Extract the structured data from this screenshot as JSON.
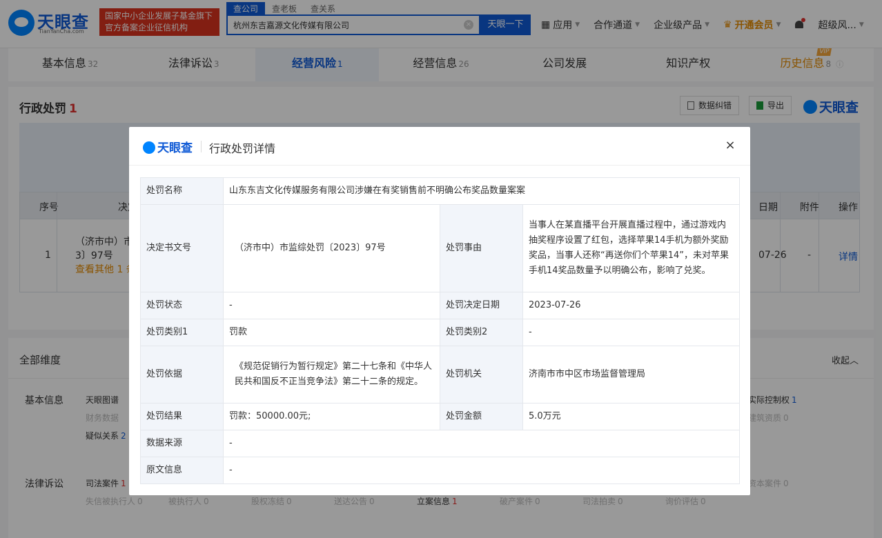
{
  "header": {
    "logo_text": "天眼查",
    "logo_sub": "TianYanCha.com",
    "gov_badge_line1": "国家中小企业发展子基金旗下",
    "gov_badge_line2": "官方备案企业征信机构",
    "search_tabs": [
      "查公司",
      "查老板",
      "查关系"
    ],
    "search_value": "杭州东吉嘉源文化传媒有限公司",
    "search_button": "天眼一下",
    "nav": {
      "apps": "应用",
      "partner": "合作通道",
      "enterprise": "企业级产品",
      "vip": "开通会员",
      "user": "超级风..."
    }
  },
  "tabs": [
    {
      "label": "基本信息",
      "count": "32"
    },
    {
      "label": "法律诉讼",
      "count": "3"
    },
    {
      "label": "经营风险",
      "count": "1"
    },
    {
      "label": "经营信息",
      "count": "26"
    },
    {
      "label": "公司发展",
      "count": ""
    },
    {
      "label": "知识产权",
      "count": ""
    },
    {
      "label": "历史信息",
      "count": "8"
    }
  ],
  "vip_tag": "VIP",
  "section": {
    "title": "行政处罚",
    "count": "1",
    "btn_correct": "数据纠错",
    "btn_export": "导出",
    "brand": "天眼查",
    "table_headers": {
      "index": "序号",
      "decision": "决定",
      "date": "日期",
      "attachment": "附件",
      "action": "操作"
    },
    "row": {
      "index": "1",
      "decision_line1": "（济市中）市监",
      "decision_line2": "3〕97号",
      "more": "查看其他 1 条",
      "date": "07-26",
      "attachment": "-",
      "action": "详情"
    }
  },
  "dims": {
    "title": "全部维度",
    "collapse": "收起",
    "basic": {
      "label": "基本信息",
      "item1": "天眼图谱",
      "item2": "财务数据",
      "item3": "疑似关系",
      "item3_count": "2",
      "right1": "实际控制权",
      "right1_count": "1",
      "right2": "建筑资质",
      "right2_count": "0"
    },
    "legal": {
      "label": "法律诉讼",
      "items_row1": [
        {
          "label": "司法案件",
          "count": "1"
        },
        {
          "label": "资本案件",
          "count": "0"
        }
      ],
      "items_row2": [
        {
          "label": "失信被执行人",
          "count": "0"
        },
        {
          "label": "被执行人",
          "count": "0"
        },
        {
          "label": "股权冻结",
          "count": "0"
        },
        {
          "label": "送达公告",
          "count": "0"
        },
        {
          "label": "立案信息",
          "count": "1"
        },
        {
          "label": "破产案件",
          "count": "0"
        },
        {
          "label": "司法拍卖",
          "count": "0"
        },
        {
          "label": "询价评估",
          "count": "0"
        }
      ]
    }
  },
  "modal": {
    "logo": "天眼查",
    "title": "行政处罚详情",
    "close": "×",
    "rows": {
      "name_label": "处罚名称",
      "name_value": "山东东吉文化传媒服务有限公司涉嫌在有奖销售前不明确公布奖品数量案案",
      "docno_label": "决定书文号",
      "docno_value": "（济市中）市监综处罚〔2023〕97号",
      "reason_label": "处罚事由",
      "reason_value": "当事人在某直播平台开展直播过程中，通过游戏内抽奖程序设置了红包，选择苹果14手机为额外奖励奖品，当事人还称“再送你们个苹果14”，未对苹果手机14奖品数量予以明确公布，影响了兑奖。",
      "status_label": "处罚状态",
      "status_value": "-",
      "date_label": "处罚决定日期",
      "date_value": "2023-07-26",
      "type1_label": "处罚类别1",
      "type1_value": "罚款",
      "type2_label": "处罚类别2",
      "type2_value": "-",
      "basis_label": "处罚依据",
      "basis_value": "《规范促销行为暂行规定》第二十七条和《中华人民共和国反不正当竞争法》第二十二条的规定。",
      "authority_label": "处罚机关",
      "authority_value": "济南市市中区市场监督管理局",
      "result_label": "处罚结果",
      "result_value": "罚款：50000.00元;",
      "amount_label": "处罚金额",
      "amount_value": "5.0万元",
      "source_label": "数据来源",
      "source_value": "-",
      "original_label": "原文信息",
      "original_value": "-"
    }
  },
  "colors": {
    "brand_blue": "#0f5ad6",
    "badge_red": "#d9321f",
    "vip_orange": "#e58a00"
  }
}
